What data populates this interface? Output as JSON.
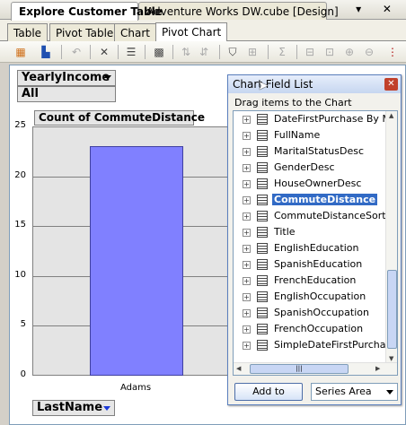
{
  "doc_tabs": [
    {
      "label": "Explore Customer Table",
      "active": true
    },
    {
      "label": "Adventure Works DW.cube [Design]",
      "active": false
    }
  ],
  "doc_controls": "▾ ✕",
  "sub_tabs": [
    {
      "label": "Table"
    },
    {
      "label": "Pivot Table"
    },
    {
      "label": "Chart"
    },
    {
      "label": "Pivot Chart",
      "active": true
    }
  ],
  "filter": {
    "field": "YearlyIncome",
    "value": "All"
  },
  "data_field": "Count of CommuteDistance",
  "category_field": "LastName",
  "chart_data": {
    "type": "bar",
    "categories": [
      "Adams"
    ],
    "series": [
      {
        "values": [
          23
        ]
      }
    ],
    "ylim": [
      0,
      25
    ],
    "yticks": [
      0,
      5,
      10,
      15,
      20,
      25
    ],
    "grid": true,
    "bar_color": "#8080ff",
    "plot_background": "#e4e4e4"
  },
  "field_list": {
    "title": "Chart Field List",
    "hint": "Drag items to the Chart",
    "items": [
      {
        "label": "DateFirstPurchase By Mo"
      },
      {
        "label": "FullName"
      },
      {
        "label": "MaritalStatusDesc"
      },
      {
        "label": "GenderDesc"
      },
      {
        "label": "HouseOwnerDesc"
      },
      {
        "label": "CommuteDistance",
        "selected": true
      },
      {
        "label": "CommuteDistanceSort"
      },
      {
        "label": "Title"
      },
      {
        "label": "EnglishEducation"
      },
      {
        "label": "SpanishEducation"
      },
      {
        "label": "FrenchEducation"
      },
      {
        "label": "EnglishOccupation"
      },
      {
        "label": "SpanishOccupation"
      },
      {
        "label": "FrenchOccupation"
      },
      {
        "label": "SimpleDateFirstPurchase"
      }
    ],
    "add_button": "Add to",
    "area_select": "Series Area",
    "selection_color": "#316ac5"
  },
  "toolbar_icons": [
    "field-list-icon",
    "chart-type-icon",
    "undo-icon",
    "delete-icon",
    "properties-icon",
    "pivot-icon",
    "sort-asc-icon",
    "sort-desc-icon",
    "filter-icon",
    "show-top-icon",
    "autosum-icon",
    "group-icon",
    "ungroup-icon",
    "expand-icon",
    "collapse-icon",
    "drill-icon"
  ]
}
